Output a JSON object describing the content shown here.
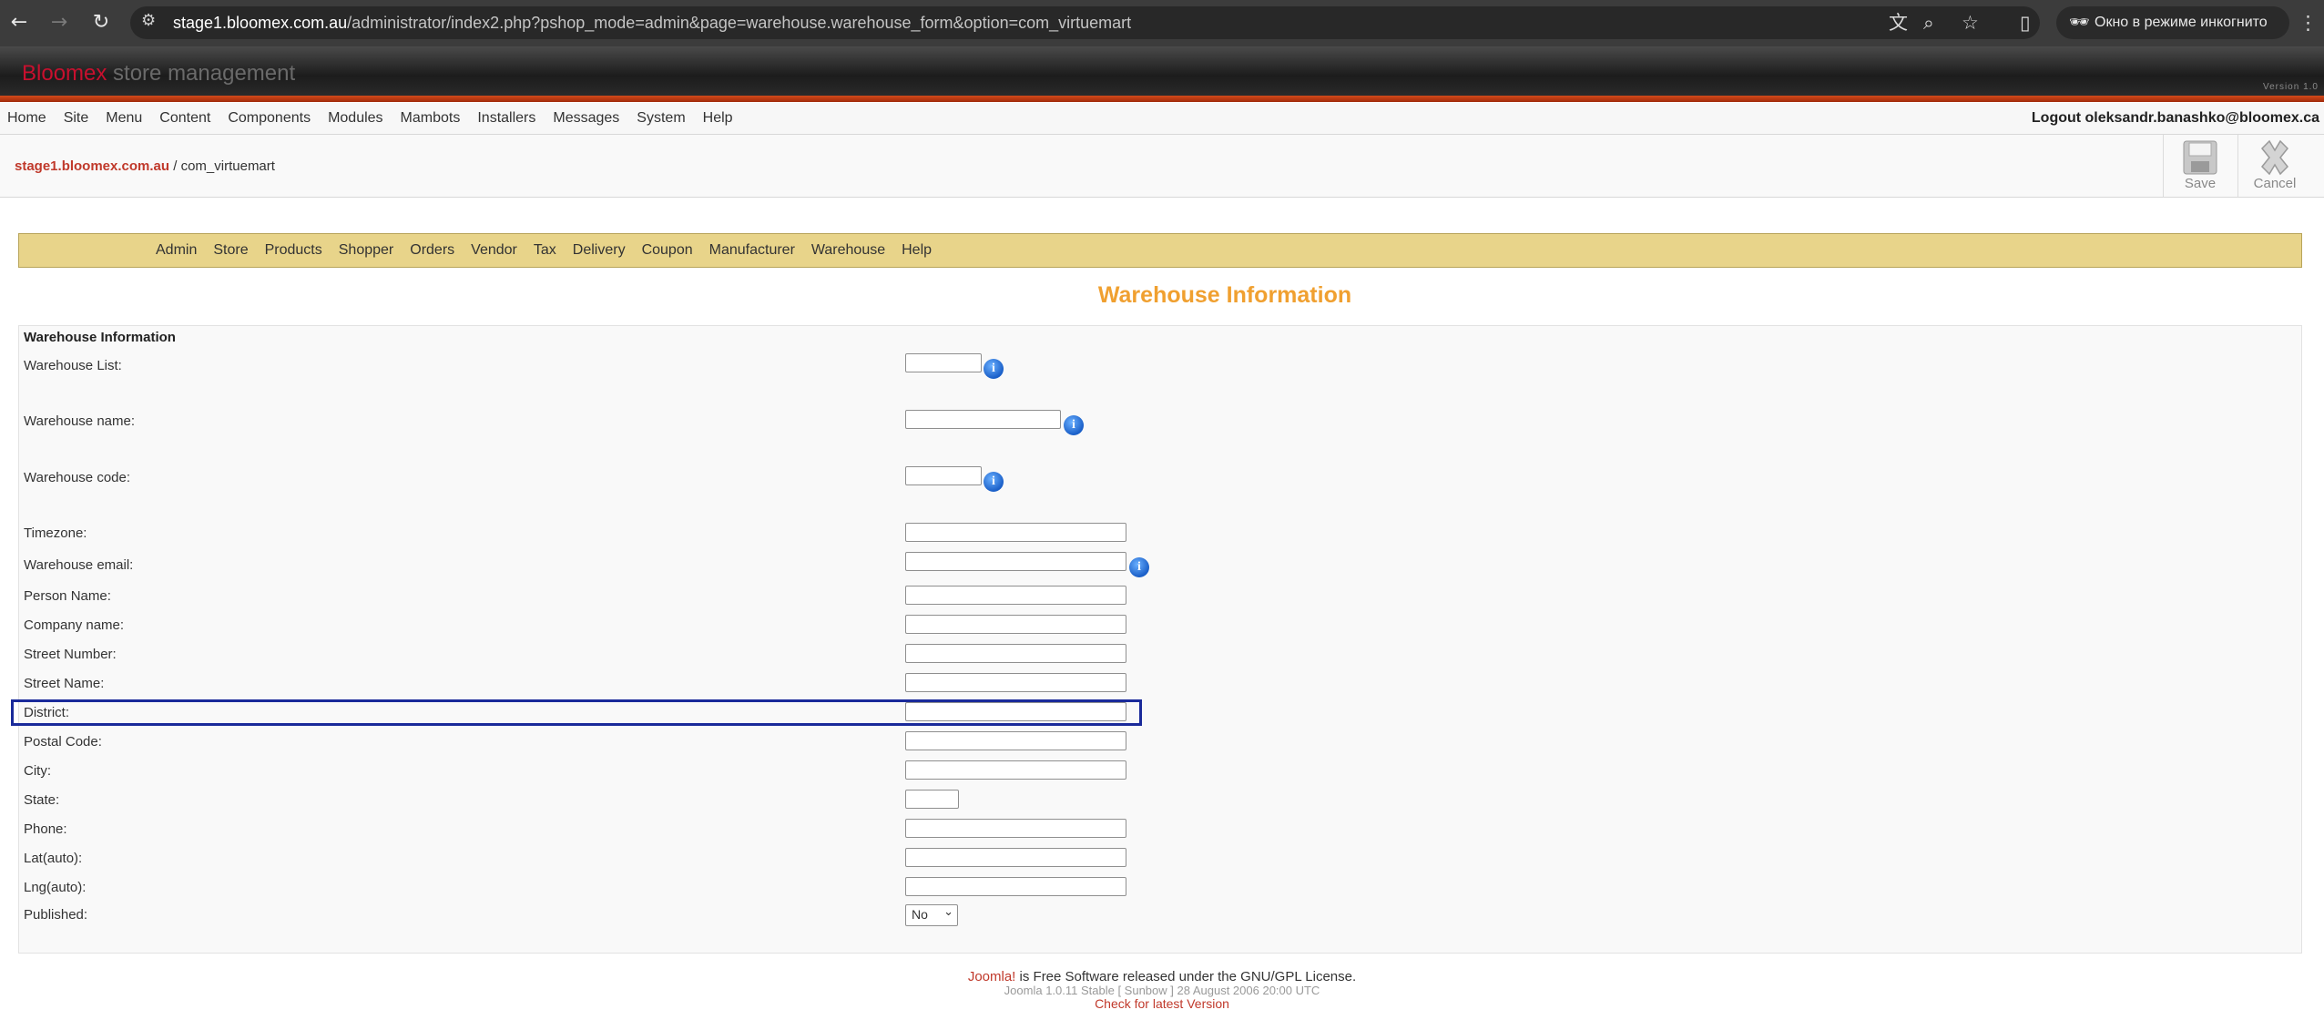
{
  "browser": {
    "url_host": "stage1.bloomex.com.au",
    "url_rest": "/administrator/index2.php?pshop_mode=admin&page=warehouse.warehouse_form&option=com_virtuemart",
    "incognito_label": "Окно в режиме инкогнито",
    "icons": [
      "back-icon",
      "forward-icon",
      "reload-icon",
      "site-info-icon",
      "translate-icon",
      "zoom-icon",
      "bookmark-star-icon",
      "side-panel-icon",
      "incognito-icon",
      "menu-kebab-icon"
    ]
  },
  "header": {
    "brand_part1": "Bloomex",
    "brand_part2": " store management",
    "version": "Version 1.0"
  },
  "menubar": {
    "items": [
      "Home",
      "Site",
      "Menu",
      "Content",
      "Components",
      "Modules",
      "Mambots",
      "Installers",
      "Messages",
      "System",
      "Help"
    ],
    "logout": "Logout oleksandr.banashko@bloomex.ca"
  },
  "pathway": {
    "host": "stage1.bloomex.com.au",
    "separator": " / ",
    "component": "com_virtuemart"
  },
  "toolbar": {
    "save": "Save",
    "cancel": "Cancel"
  },
  "vm_menu": {
    "items": [
      "Admin",
      "Store",
      "Products",
      "Shopper",
      "Orders",
      "Vendor",
      "Tax",
      "Delivery",
      "Coupon",
      "Manufacturer",
      "Warehouse",
      "Help"
    ]
  },
  "page_title": "Warehouse Information",
  "form": {
    "heading": "Warehouse Information",
    "fields": [
      {
        "label": "Warehouse List:",
        "value": ""
      },
      {
        "label": "Warehouse name:",
        "value": ""
      },
      {
        "label": "Warehouse code:",
        "value": ""
      },
      {
        "label": "Timezone:",
        "value": ""
      },
      {
        "label": "Warehouse email:",
        "value": ""
      },
      {
        "label": "Person Name:",
        "value": ""
      },
      {
        "label": "Company name:",
        "value": ""
      },
      {
        "label": "Street Number:",
        "value": ""
      },
      {
        "label": "Street Name:",
        "value": ""
      },
      {
        "label": "District:",
        "value": ""
      },
      {
        "label": "Postal Code:",
        "value": ""
      },
      {
        "label": "City:",
        "value": ""
      },
      {
        "label": "State:",
        "value": ""
      },
      {
        "label": "Phone:",
        "value": ""
      },
      {
        "label": "Lat(auto):",
        "value": ""
      },
      {
        "label": "Lng(auto):",
        "value": ""
      },
      {
        "label": "Published:",
        "value": "No"
      }
    ]
  },
  "footer": {
    "joomla_link": "Joomla!",
    "license": " is Free Software released under the GNU/GPL License.",
    "version": "Joomla 1.0.11 Stable [ Sunbow ] 28 August 2006 20:00 UTC",
    "check": "Check for latest Version"
  },
  "colors": {
    "accent_orange": "#f0a030",
    "brand_red": "#c8102e",
    "vm_menu_bg": "#e8d48a",
    "highlight_border": "#1a2a9a"
  }
}
